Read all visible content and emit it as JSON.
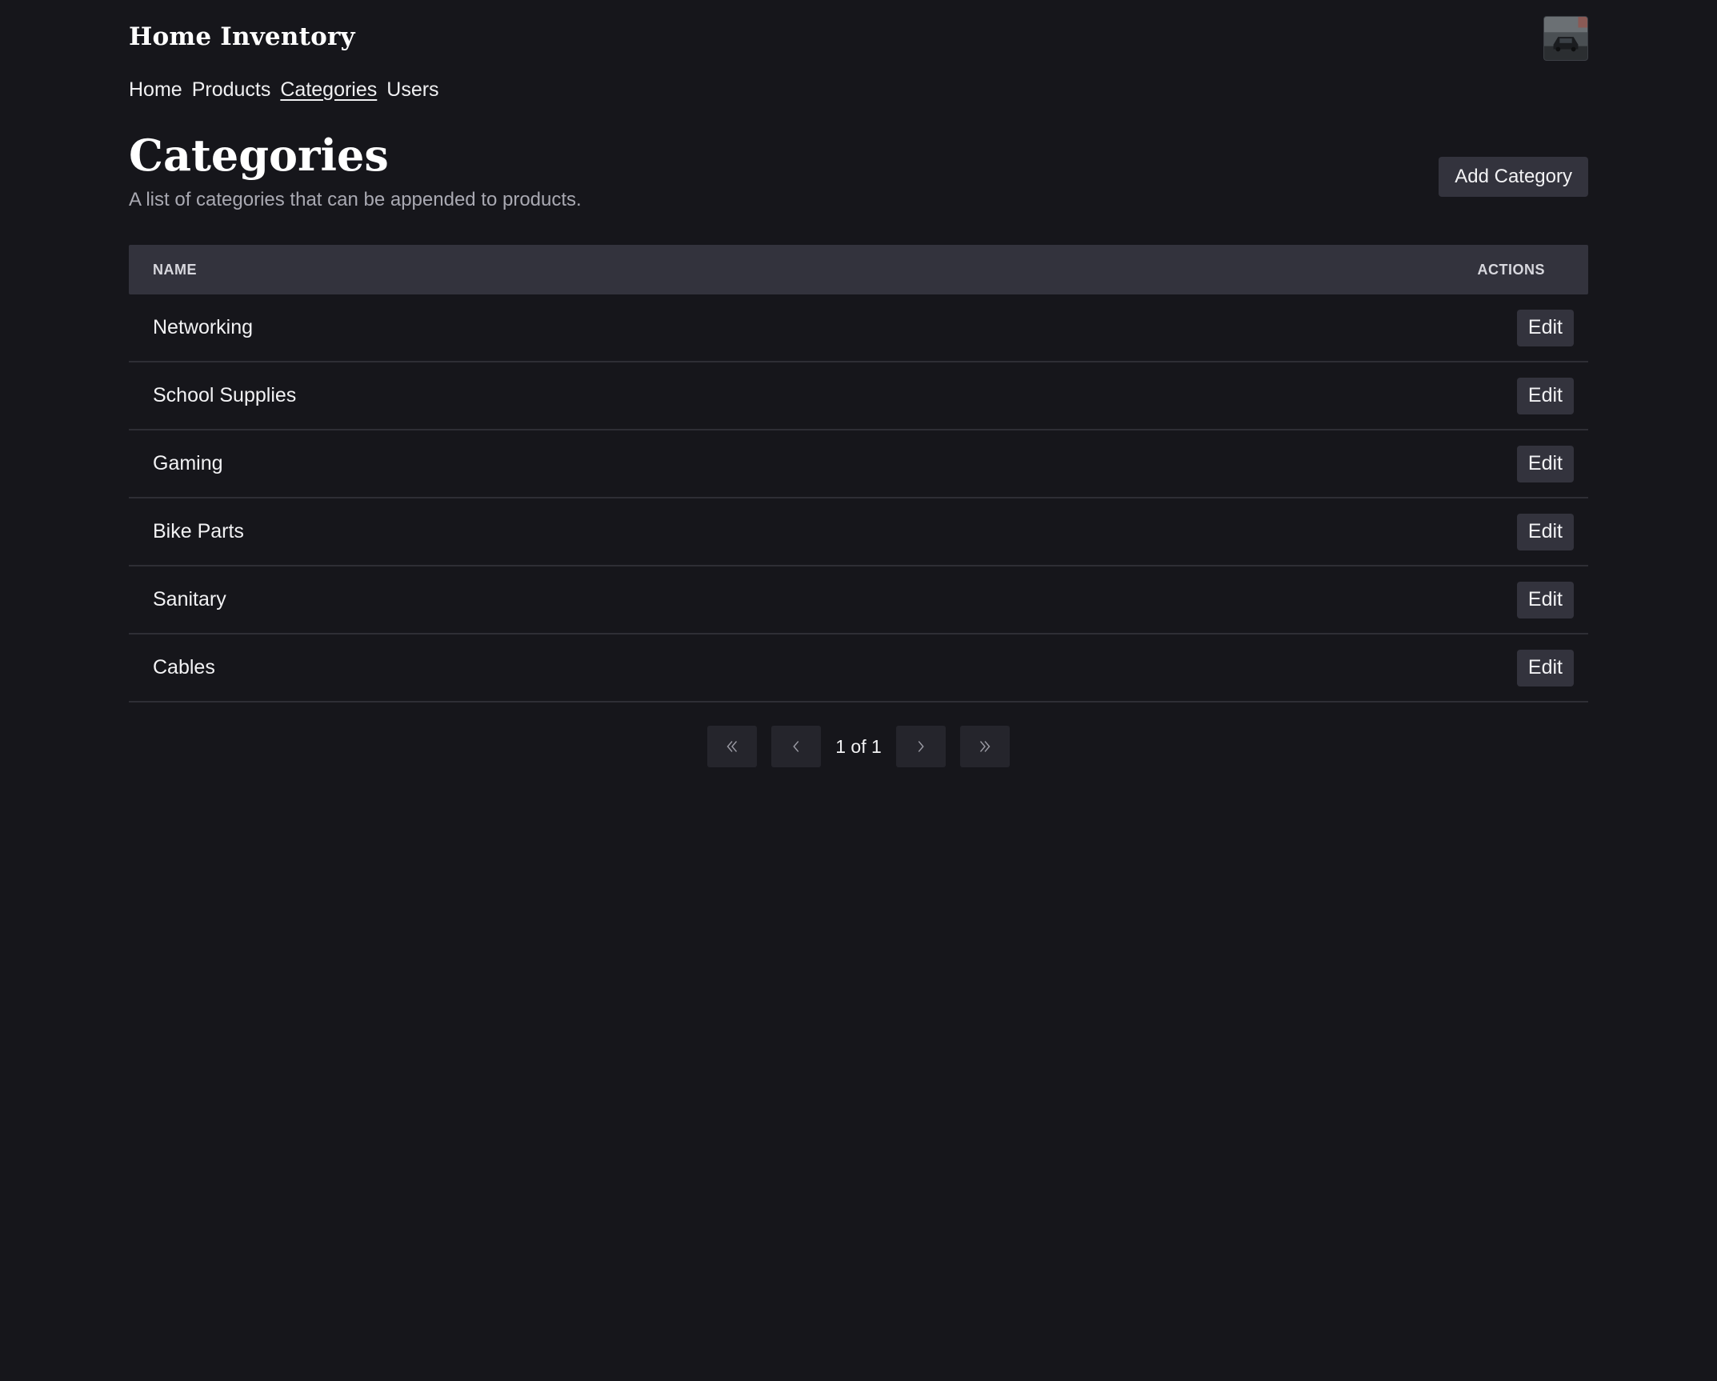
{
  "app": {
    "title": "Home Inventory"
  },
  "nav": {
    "items": [
      {
        "label": "Home",
        "active": false
      },
      {
        "label": "Products",
        "active": false
      },
      {
        "label": "Categories",
        "active": true
      },
      {
        "label": "Users",
        "active": false
      }
    ]
  },
  "header": {
    "title": "Categories",
    "subtitle": "A list of categories that can be appended to products.",
    "add_label": "Add Category"
  },
  "table": {
    "columns": {
      "name": "NAME",
      "actions": "ACTIONS"
    },
    "edit_label": "Edit",
    "rows": [
      {
        "name": "Networking"
      },
      {
        "name": "School Supplies"
      },
      {
        "name": "Gaming"
      },
      {
        "name": "Bike Parts"
      },
      {
        "name": "Sanitary"
      },
      {
        "name": "Cables"
      }
    ]
  },
  "pagination": {
    "label": "1 of 1",
    "icons": {
      "first": "chevrons-left-icon",
      "prev": "chevron-left-icon",
      "next": "chevron-right-icon",
      "last": "chevrons-right-icon"
    }
  },
  "colors": {
    "background": "#16161b",
    "surface": "#33333d",
    "text": "#f2f2f4",
    "muted": "#a9a9b2",
    "divider": "#2e2e35"
  }
}
